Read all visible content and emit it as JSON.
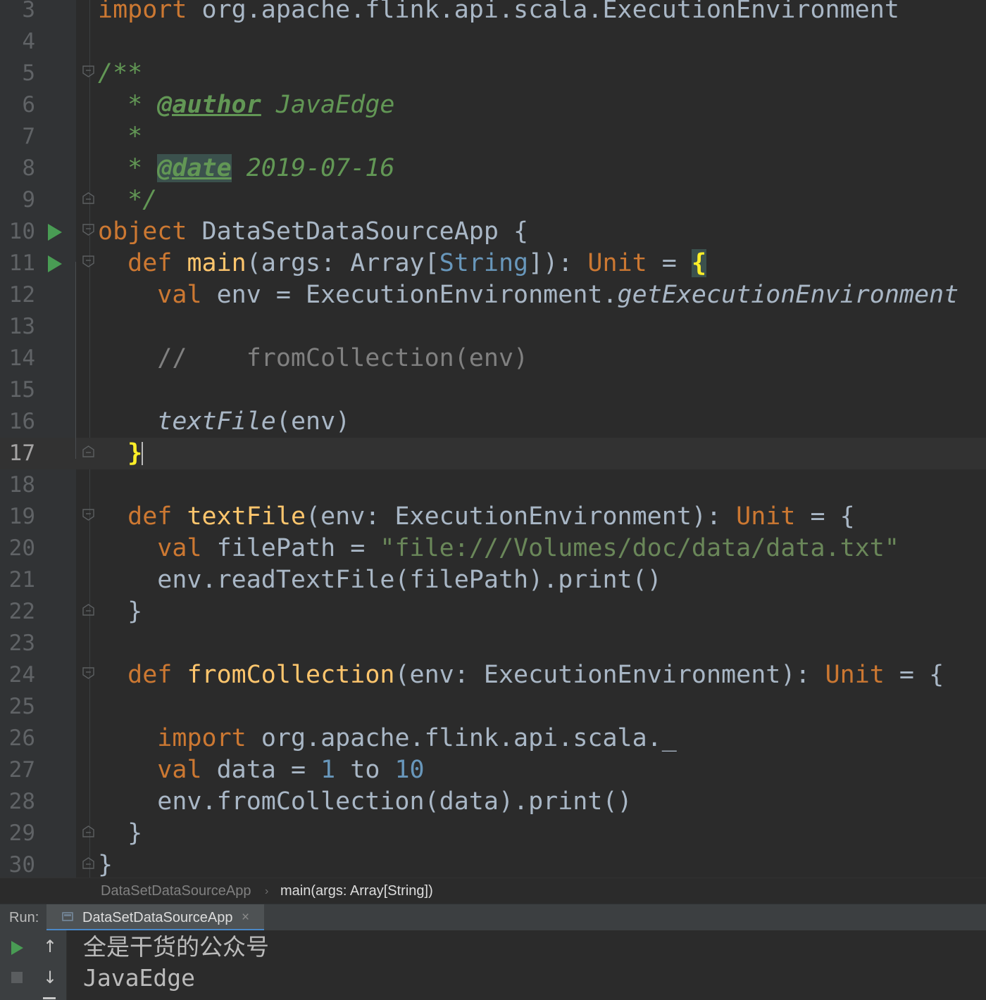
{
  "editor": {
    "lines": [
      {
        "n": "3",
        "tokens": [
          {
            "t": "import ",
            "c": "kw"
          },
          {
            "t": "org.apache.flink.api.scala.ExecutionEnvironment",
            "c": ""
          }
        ]
      },
      {
        "n": "4",
        "tokens": []
      },
      {
        "n": "5",
        "tokens": [
          {
            "t": "/**",
            "c": "doc"
          }
        ]
      },
      {
        "n": "6",
        "tokens": [
          {
            "t": "  * ",
            "c": "doc"
          },
          {
            "t": "@author",
            "c": "doctag"
          },
          {
            "t": " JavaEdge",
            "c": "doc"
          }
        ]
      },
      {
        "n": "7",
        "tokens": [
          {
            "t": "  *",
            "c": "doc"
          }
        ]
      },
      {
        "n": "8",
        "tokens": [
          {
            "t": "  * ",
            "c": "doc"
          },
          {
            "t": "@date",
            "c": "doctag hl"
          },
          {
            "t": " 2019-07-16",
            "c": "doc"
          }
        ]
      },
      {
        "n": "9",
        "tokens": [
          {
            "t": "  */",
            "c": "doc"
          }
        ]
      },
      {
        "n": "10",
        "tokens": [
          {
            "t": "object ",
            "c": "kw"
          },
          {
            "t": "DataSetDataSourceApp {",
            "c": ""
          }
        ]
      },
      {
        "n": "11",
        "tokens": [
          {
            "t": "  ",
            "c": ""
          },
          {
            "t": "def ",
            "c": "kw"
          },
          {
            "t": "main",
            "c": "fn"
          },
          {
            "t": "(args: Array[",
            "c": ""
          },
          {
            "t": "String",
            "c": "tp"
          },
          {
            "t": "]): ",
            "c": ""
          },
          {
            "t": "Unit",
            "c": "kw"
          },
          {
            "t": " = ",
            "c": ""
          },
          {
            "t": "{",
            "c": "brace-hl-bg"
          }
        ]
      },
      {
        "n": "12",
        "tokens": [
          {
            "t": "    ",
            "c": ""
          },
          {
            "t": "val ",
            "c": "kw"
          },
          {
            "t": "env = ExecutionEnvironment.",
            "c": ""
          },
          {
            "t": "getExecutionEnvironment",
            "c": "it"
          }
        ]
      },
      {
        "n": "13",
        "tokens": []
      },
      {
        "n": "14",
        "tokens": [
          {
            "t": "    //    fromCollection(env)",
            "c": "cm"
          }
        ]
      },
      {
        "n": "15",
        "tokens": []
      },
      {
        "n": "16",
        "tokens": [
          {
            "t": "    ",
            "c": ""
          },
          {
            "t": "textFile",
            "c": "it"
          },
          {
            "t": "(env)",
            "c": ""
          }
        ]
      },
      {
        "n": "17",
        "tokens": [
          {
            "t": "  ",
            "c": ""
          },
          {
            "t": "}",
            "c": "brace-hl"
          }
        ]
      },
      {
        "n": "18",
        "tokens": []
      },
      {
        "n": "19",
        "tokens": [
          {
            "t": "  ",
            "c": ""
          },
          {
            "t": "def ",
            "c": "kw"
          },
          {
            "t": "textFile",
            "c": "fn"
          },
          {
            "t": "(env: ExecutionEnvironment): ",
            "c": ""
          },
          {
            "t": "Unit",
            "c": "kw"
          },
          {
            "t": " = {",
            "c": ""
          }
        ]
      },
      {
        "n": "20",
        "tokens": [
          {
            "t": "    ",
            "c": ""
          },
          {
            "t": "val ",
            "c": "kw"
          },
          {
            "t": "filePath = ",
            "c": ""
          },
          {
            "t": "\"file:///Volumes/doc/data/data.txt\"",
            "c": "str"
          }
        ]
      },
      {
        "n": "21",
        "tokens": [
          {
            "t": "    env.readTextFile(filePath).print()",
            "c": ""
          }
        ]
      },
      {
        "n": "22",
        "tokens": [
          {
            "t": "  }",
            "c": ""
          }
        ]
      },
      {
        "n": "23",
        "tokens": []
      },
      {
        "n": "24",
        "tokens": [
          {
            "t": "  ",
            "c": ""
          },
          {
            "t": "def ",
            "c": "kw"
          },
          {
            "t": "fromCollection",
            "c": "fn"
          },
          {
            "t": "(env: ExecutionEnvironment): ",
            "c": ""
          },
          {
            "t": "Unit",
            "c": "kw"
          },
          {
            "t": " = {",
            "c": ""
          }
        ]
      },
      {
        "n": "25",
        "tokens": []
      },
      {
        "n": "26",
        "tokens": [
          {
            "t": "    ",
            "c": ""
          },
          {
            "t": "import ",
            "c": "kw"
          },
          {
            "t": "org.apache.flink.api.scala._",
            "c": ""
          }
        ]
      },
      {
        "n": "27",
        "tokens": [
          {
            "t": "    ",
            "c": ""
          },
          {
            "t": "val ",
            "c": "kw"
          },
          {
            "t": "data = ",
            "c": ""
          },
          {
            "t": "1",
            "c": "num"
          },
          {
            "t": " to ",
            "c": ""
          },
          {
            "t": "10",
            "c": "num"
          }
        ]
      },
      {
        "n": "28",
        "tokens": [
          {
            "t": "    env.fromCollection(data).print()",
            "c": ""
          }
        ]
      },
      {
        "n": "29",
        "tokens": [
          {
            "t": "  }",
            "c": ""
          }
        ]
      },
      {
        "n": "30",
        "tokens": [
          {
            "t": "}",
            "c": ""
          }
        ]
      }
    ],
    "current_line": "17",
    "run_gutter_lines": [
      "10",
      "11"
    ],
    "fold_lines": [
      "5",
      "9",
      "10",
      "11",
      "17",
      "19",
      "22",
      "24",
      "29",
      "30"
    ],
    "fold_end_lines": [
      "9",
      "17",
      "22",
      "29",
      "30"
    ]
  },
  "breadcrumb": {
    "items": [
      "DataSetDataSourceApp",
      "main(args: Array[String])"
    ],
    "separator": "›"
  },
  "run_panel": {
    "label": "Run:",
    "tab_title": "DataSetDataSourceApp",
    "close_glyph": "×",
    "up_glyph": "↑",
    "down_glyph": "↓",
    "output": [
      "全是干货的公众号",
      "JavaEdge"
    ]
  },
  "colors": {
    "background": "#2b2b2b",
    "keyword": "#cc7832",
    "function": "#ffc66d",
    "string": "#6a8759",
    "number": "#6897bb",
    "doc": "#629755",
    "run_green": "#499c54"
  }
}
